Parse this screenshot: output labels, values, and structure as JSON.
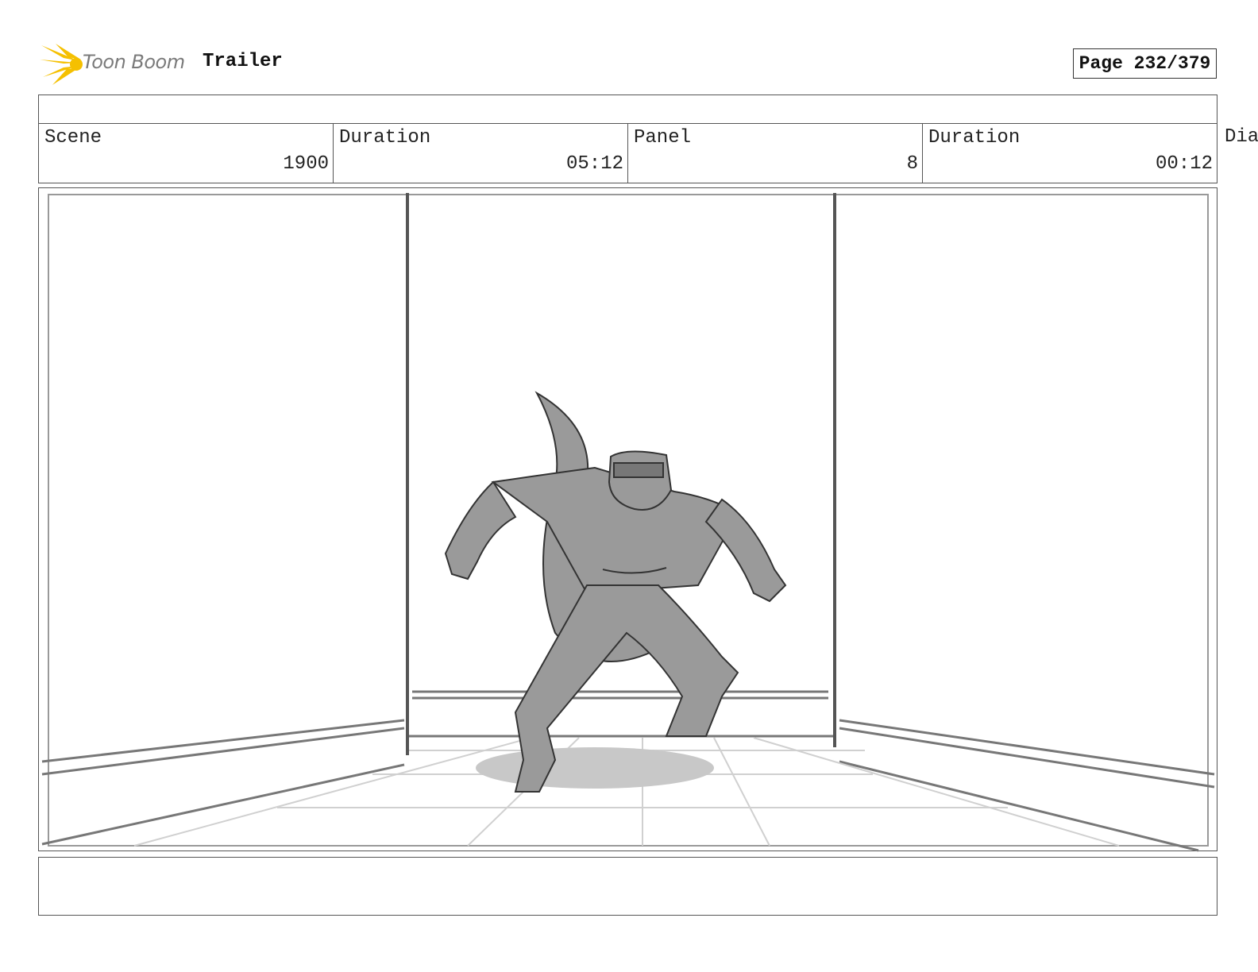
{
  "header": {
    "logo_text": "Toon Boom",
    "title": "Trailer",
    "page": "Page 232/379"
  },
  "info": {
    "scene_label": "Scene",
    "scene_value": "1900",
    "duration_label": "Duration",
    "duration_value": "05:12",
    "panel_label": "Panel",
    "panel_value": "8",
    "panel_duration_label": "Duration",
    "panel_duration_value": "00:12",
    "dialogue_label": "Dia"
  },
  "colors": {
    "logo_accent": "#f5c000",
    "figure_fill": "#9a9a9a",
    "line": "#333333"
  }
}
